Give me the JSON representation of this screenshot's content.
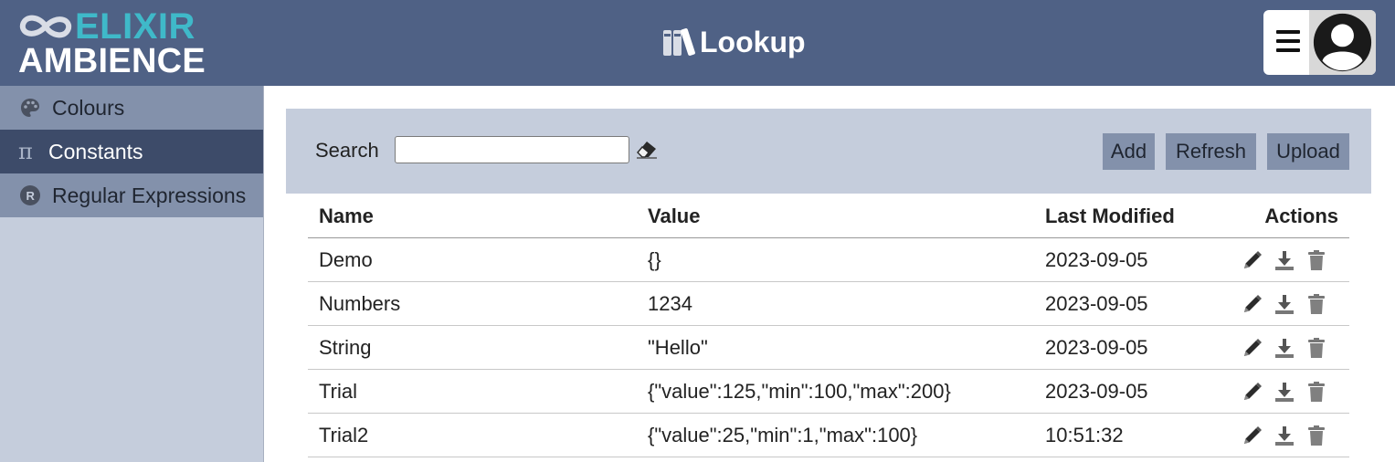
{
  "app": {
    "logo_line1": "ELIXIR",
    "logo_line2": "AMBIENCE",
    "title": "Lookup",
    "menu_icon": "hamburger-icon",
    "avatar_icon": "user-avatar-icon"
  },
  "colors": {
    "header_bg": "#4f6185",
    "logo_accent": "#3fb9c9",
    "sidebar_bg": "#c5cddc",
    "sidebar_item_bg": "#8391ab",
    "sidebar_active_bg": "#3d4b69",
    "button_bg": "#8391ab"
  },
  "sidebar": {
    "items": [
      {
        "label": "Colours",
        "icon": "palette-icon",
        "active": false
      },
      {
        "label": "Constants",
        "icon": "pi-icon",
        "active": true
      },
      {
        "label": "Regular Expressions",
        "icon": "regex-r-icon",
        "active": false
      }
    ]
  },
  "toolbar": {
    "search_label": "Search",
    "search_value": "",
    "search_placeholder": "",
    "clear_icon": "eraser-icon",
    "add_label": "Add",
    "refresh_label": "Refresh",
    "upload_label": "Upload"
  },
  "table": {
    "columns": [
      "Name",
      "Value",
      "Last Modified",
      "Actions"
    ],
    "rows": [
      {
        "name": "Demo",
        "value": "{}",
        "modified": "2023-09-05"
      },
      {
        "name": "Numbers",
        "value": "1234",
        "modified": "2023-09-05"
      },
      {
        "name": "String",
        "value": "\"Hello\"",
        "modified": "2023-09-05"
      },
      {
        "name": "Trial",
        "value": "{\"value\":125,\"min\":100,\"max\":200}",
        "modified": "2023-09-05"
      },
      {
        "name": "Trial2",
        "value": "{\"value\":25,\"min\":1,\"max\":100}",
        "modified": "10:51:32"
      }
    ],
    "row_actions": [
      "edit-pencil-icon",
      "download-icon",
      "trash-icon"
    ]
  }
}
